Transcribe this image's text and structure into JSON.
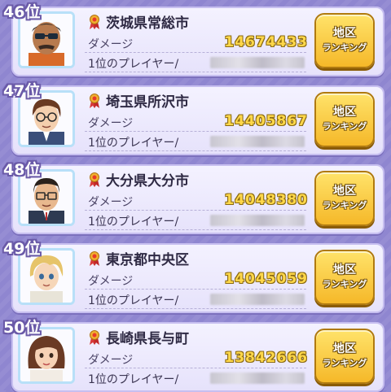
{
  "theme": {
    "background": "#8f86d0",
    "card": "#ece9fb",
    "damage_value_color": "#ffd84a",
    "button_color": "#f5c233"
  },
  "labels": {
    "damage": "ダメージ",
    "top_player": "1位のプレイヤー/",
    "button_line1": "地区",
    "button_line2": "ランキング"
  },
  "rows": [
    {
      "rank": "46位",
      "region": "茨城県常総市",
      "damage": "14674433",
      "avatar": "man-sunglasses-mustache"
    },
    {
      "rank": "47位",
      "region": "埼玉県所沢市",
      "damage": "14405867",
      "avatar": "man-glasses-brown-hair"
    },
    {
      "rank": "48位",
      "region": "大分県大分市",
      "damage": "14048380",
      "avatar": "man-glasses-dark-hair"
    },
    {
      "rank": "49位",
      "region": "東京都中央区",
      "damage": "14045059",
      "avatar": "boy-blonde-hair"
    },
    {
      "rank": "50位",
      "region": "長崎県長与町",
      "damage": "13842666",
      "avatar": "woman-brown-hair"
    }
  ]
}
